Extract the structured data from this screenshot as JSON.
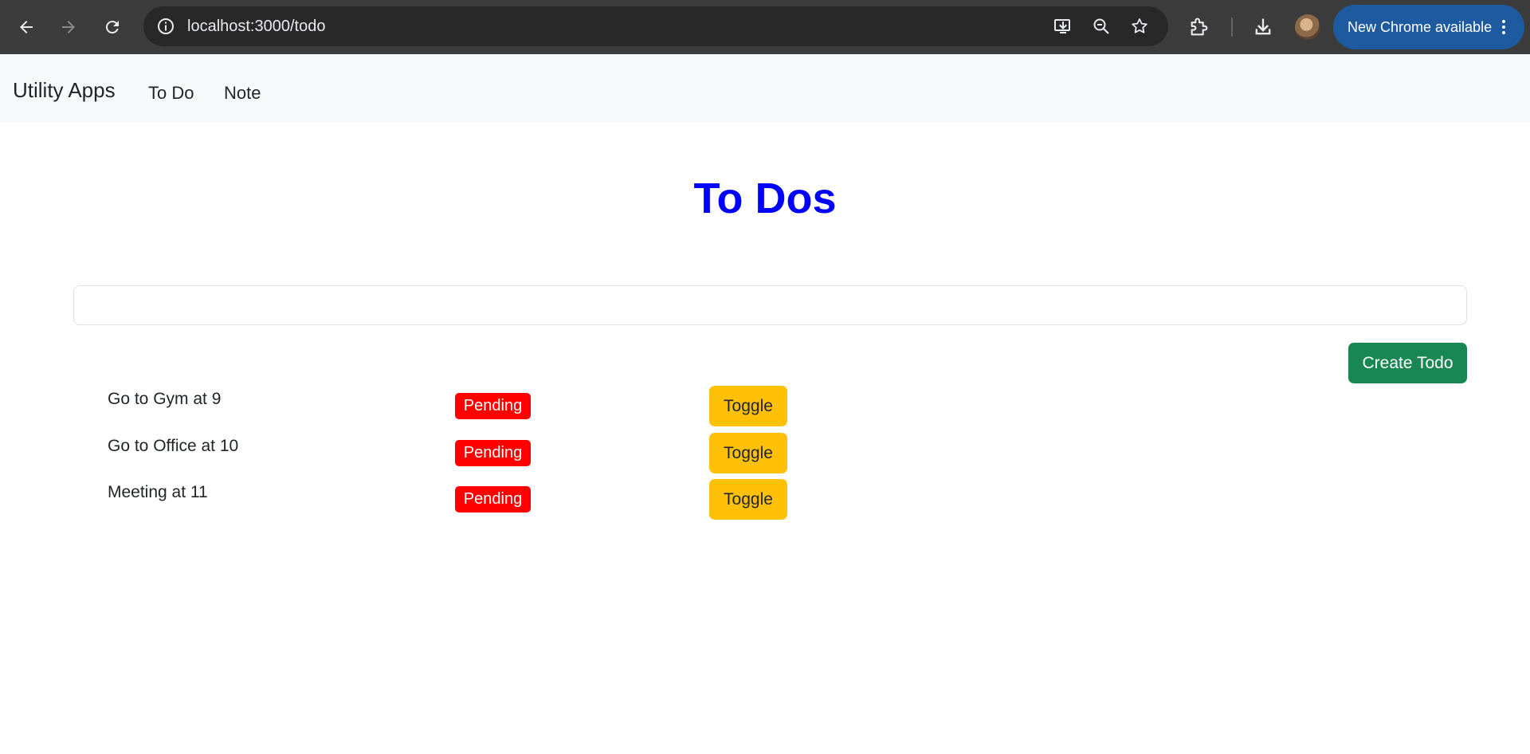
{
  "browser": {
    "url": "localhost:3000/todo",
    "update_label": "New Chrome available",
    "icons": {
      "back": "arrow-left-icon",
      "forward": "arrow-right-icon",
      "reload": "reload-icon",
      "site_info": "info-icon",
      "install_app": "install-app-icon",
      "zoom": "zoom-out-icon",
      "bookmark": "star-icon",
      "extensions": "puzzle-icon",
      "downloads": "download-icon",
      "menu": "kebab-menu-icon"
    }
  },
  "navbar": {
    "brand": "Utility Apps",
    "links": [
      {
        "label": "To Do"
      },
      {
        "label": "Note"
      }
    ]
  },
  "main": {
    "title": "To Dos",
    "input": {
      "value": "",
      "placeholder": ""
    },
    "create_label": "Create Todo",
    "todos": [
      {
        "title": "Go to Gym at 9",
        "status": "Pending",
        "toggle_label": "Toggle"
      },
      {
        "title": "Go to Office at 10",
        "status": "Pending",
        "toggle_label": "Toggle"
      },
      {
        "title": "Meeting at 11",
        "status": "Pending",
        "toggle_label": "Toggle"
      }
    ]
  },
  "colors": {
    "title": "#0000ff",
    "create_button": "#198754",
    "pending_badge": "#ff0000",
    "toggle_button": "#ffc107",
    "navbar_bg": "#f8f9fa",
    "chrome_bg": "#3c3c3c",
    "update_chip": "#1e5aa0"
  }
}
